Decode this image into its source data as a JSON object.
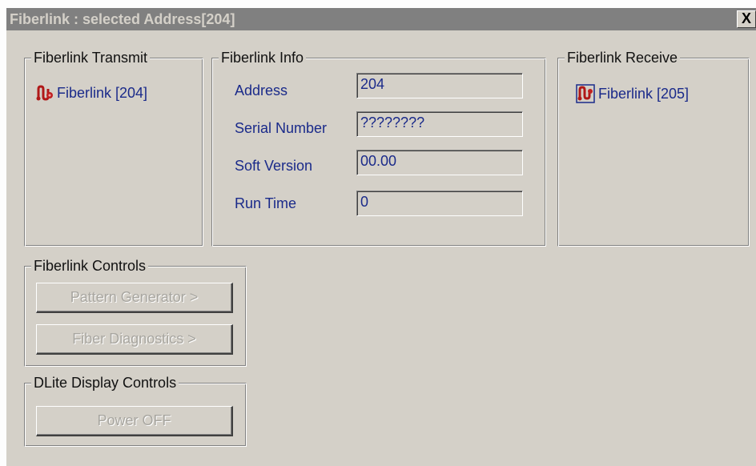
{
  "window": {
    "title": "Fiberlink : selected Address[204]",
    "close_label": "X"
  },
  "transmit": {
    "title": "Fiberlink Transmit",
    "item_label": "Fiberlink [204]",
    "icon": "fiberlink-transmit-icon"
  },
  "info": {
    "title": "Fiberlink Info",
    "fields": [
      {
        "label": "Address",
        "value": "204"
      },
      {
        "label": "Serial Number",
        "value": "????????"
      },
      {
        "label": "Soft Version",
        "value": "00.00"
      },
      {
        "label": "Run Time",
        "value": "0"
      }
    ]
  },
  "receive": {
    "title": "Fiberlink Receive",
    "item_label": "Fiberlink [205]",
    "icon": "fiberlink-receive-icon"
  },
  "controls": {
    "title": "Fiberlink Controls",
    "pattern_button": "Pattern Generator >",
    "diagnostics_button": "Fiber Diagnostics >"
  },
  "dlite": {
    "title": "DLite Display Controls",
    "power_button": "Power OFF"
  },
  "colors": {
    "face": "#d4d0c8",
    "titlebar": "#808080",
    "label_text": "#1a2a8a",
    "disabled_text": "#a8a6a0"
  }
}
